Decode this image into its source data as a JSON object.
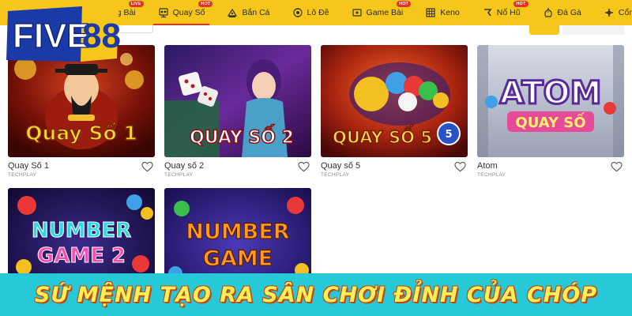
{
  "brand": {
    "logo_text_1": "FIVE",
    "logo_text_2": "88"
  },
  "nav": {
    "items": [
      {
        "label": "Sòng Bài",
        "icon": "cards-icon",
        "badge": "LIVE"
      },
      {
        "label": "Quay Số",
        "icon": "lottery-ball-icon",
        "badge": "HOT",
        "active": true
      },
      {
        "label": "Bắn Cá",
        "icon": "fish-shooter-icon",
        "badge": ""
      },
      {
        "label": "Lô Đề",
        "icon": "lotto-icon",
        "badge": ""
      },
      {
        "label": "Game Bài",
        "icon": "card-game-icon",
        "badge": "HOT"
      },
      {
        "label": "Keno",
        "icon": "keno-grid-icon",
        "badge": ""
      },
      {
        "label": "Nổ Hũ",
        "icon": "slot-icon",
        "badge": "HOT"
      },
      {
        "label": "Đá Gà",
        "icon": "rooster-icon",
        "badge": ""
      },
      {
        "label": "Cổng Game",
        "icon": "gamepad-icon",
        "badge": ""
      }
    ]
  },
  "games": [
    {
      "name": "Quay Số 1",
      "provider": "TECHPLAY",
      "art_title": "Quay Số 1"
    },
    {
      "name": "Quay số 2",
      "provider": "TECHPLAY",
      "art_title": "QUAY SỐ 2"
    },
    {
      "name": "Quay số 5",
      "provider": "TECHPLAY",
      "art_title": "QUAY SỐ 5"
    },
    {
      "name": "Atom",
      "provider": "TECHPLAY",
      "art_title": "ATOM",
      "art_subtitle": "QUAY SỐ"
    },
    {
      "art_title": "NUMBER",
      "art_subtitle": "GAME 2"
    },
    {
      "art_title": "NUMBER",
      "art_subtitle": "GAME"
    }
  ],
  "banner": {
    "text": "SỨ MỆNH TẠO RA SÂN CHƠI ĐỈNH CỦA CHÓP"
  },
  "colors": {
    "nav_bg": "#f7c61a",
    "banner_bg": "#27c9d8",
    "banner_text": "#fff05a",
    "active_underline": "#d63a1e"
  }
}
